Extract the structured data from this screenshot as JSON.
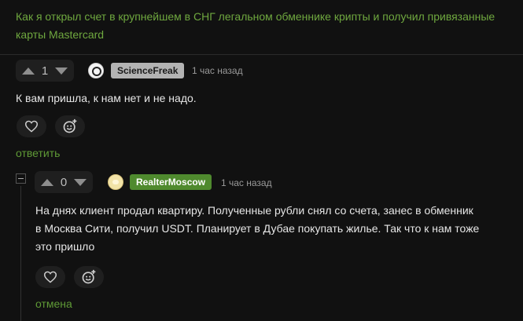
{
  "post": {
    "title": "Как я открыл счет в крупнейшем в СНГ легальном обменнике крипты и получил привязанные карты Mastercard"
  },
  "comment1": {
    "votes": "1",
    "author": "ScienceFreak",
    "time": "1 час назад",
    "text": "К вам пришла, к нам нет и не надо.",
    "reply_label": "ответить"
  },
  "comment2": {
    "votes": "0",
    "author": "RealterMoscow",
    "time": "1 час назад",
    "text_lines": [
      "На днях клиент продал квартиру. Полученные рубли снял со счета, занес в обменник",
      "в Москва Сити, получил USDT. Планирует в Дубае покупать жилье. Так что к нам тоже",
      "это пришло"
    ],
    "cancel_label": "отмена"
  },
  "colors": {
    "accent_green": "#5f9a36",
    "title_green": "#6fa83f",
    "background": "#111111"
  }
}
